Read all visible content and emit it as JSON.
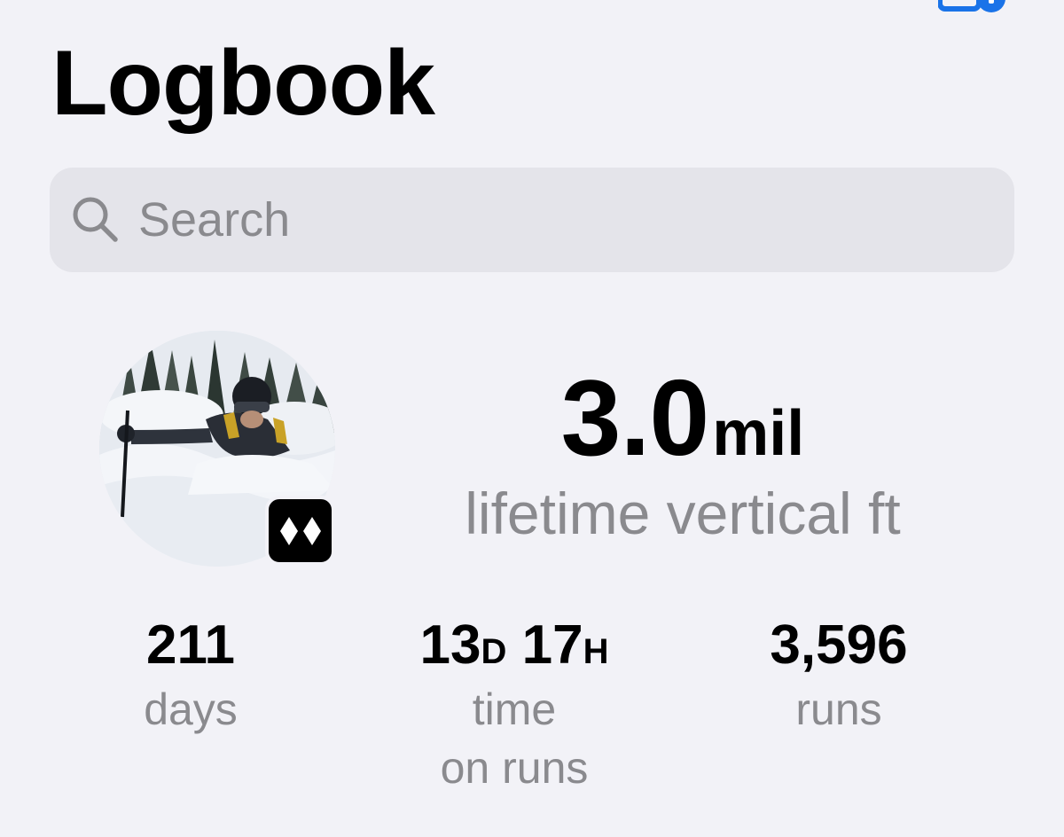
{
  "header": {
    "title": "Logbook"
  },
  "search": {
    "placeholder": "Search",
    "value": ""
  },
  "profile": {
    "avatar": "skier-in-powder-photo",
    "level_badge": "double-black-diamond-icon"
  },
  "lifetime_vertical": {
    "value": "3.0",
    "unit": "mil",
    "label": "lifetime vertical ft"
  },
  "stats": {
    "days": {
      "value": "211",
      "label": "days"
    },
    "time": {
      "days_value": "13",
      "days_unit": "D",
      "hours_value": "17",
      "hours_unit": "H",
      "label_line1": "time",
      "label_line2": "on runs"
    },
    "runs": {
      "value": "3,596",
      "label": "runs"
    }
  },
  "colors": {
    "background": "#f2f2f7",
    "search_background": "#e4e4ea",
    "secondary_text": "#8a8a8e",
    "primary_text": "#000000",
    "accent": "#1a73e8"
  }
}
